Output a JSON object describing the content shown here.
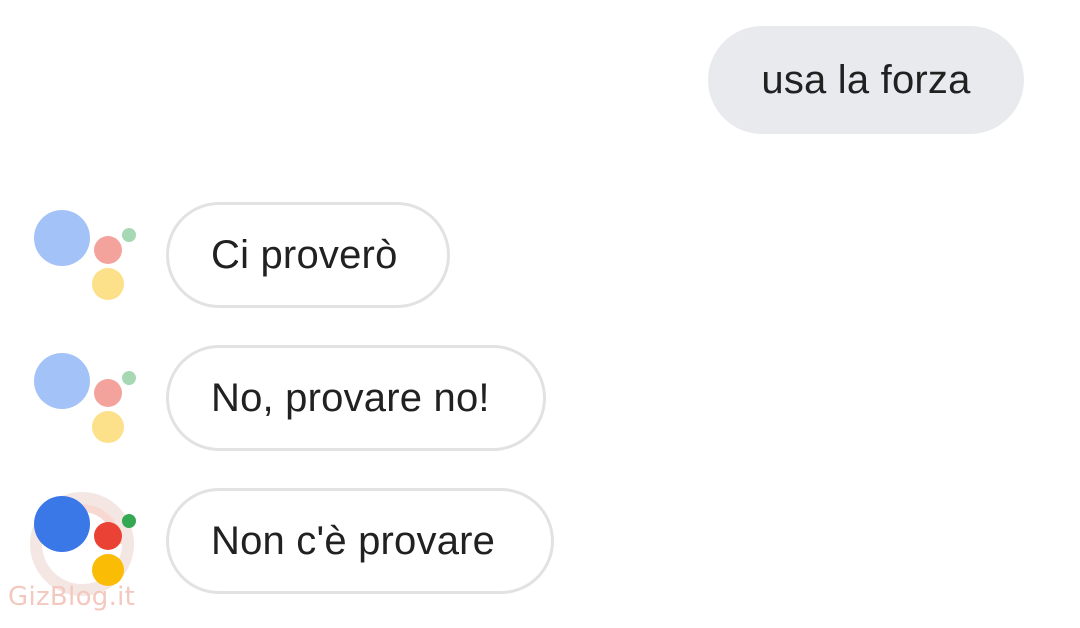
{
  "conversation": {
    "user_message": "usa la forza",
    "assistant_messages": [
      {
        "text": "Ci proverò",
        "logo_state": "inactive"
      },
      {
        "text": "No, provare no!",
        "logo_state": "inactive"
      },
      {
        "text": "Non c'è provare",
        "logo_state": "active"
      }
    ]
  },
  "icons": {
    "assistant_logo": "google-assistant-dots-icon"
  },
  "colors": {
    "user_bubble_bg": "#e9eaee",
    "assistant_bubble_border": "#e2e2e2",
    "text": "#212121",
    "blue": "#3b78e7",
    "red": "#ea4335",
    "yellow": "#fbbc05",
    "green": "#34a853"
  },
  "watermark": {
    "text": "GizBlog.it"
  }
}
